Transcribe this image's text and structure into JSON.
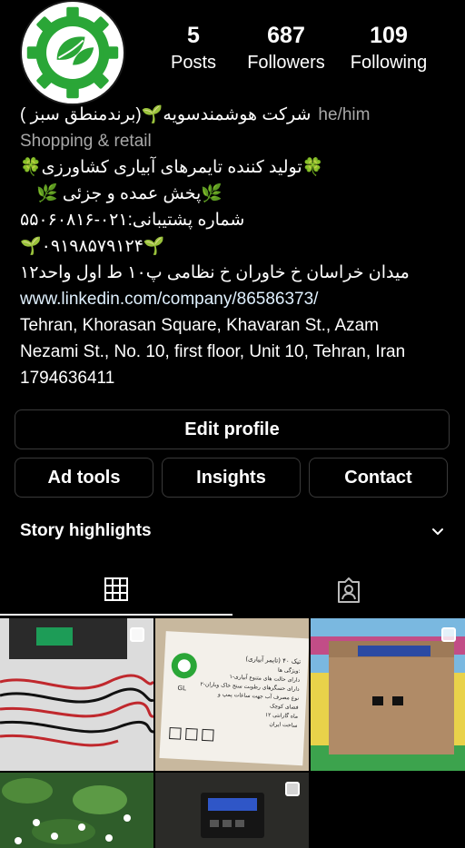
{
  "profile": {
    "stats": [
      {
        "value": "5",
        "label": "Posts"
      },
      {
        "value": "687",
        "label": "Followers"
      },
      {
        "value": "109",
        "label": "Following"
      }
    ],
    "pronouns": "he/him",
    "name_line": "شرکت هوشمندسویه🌱(برندمنطق سبز )",
    "category": "Shopping & retail",
    "bio_lines": [
      "🍀تولید کننده تایمرهای آبیاری کشاورزی🍀",
      "🌿پخش عمده و جزئی 🌿",
      "شماره پشتیبانی:۰۲۱-۵۵۰۶۰۸۱۶",
      "🌱۰۹۱۹۸۵۷۹۱۲۴🌱",
      "میدان خراسان خ خاوران خ نظامی پ۱۰ ط اول واحد۱۲"
    ],
    "website": "www.linkedin.com/company/86586373/",
    "address_lines": [
      "Tehran, Khorasan Square, Khavaran St., Azam",
      "Nezami St., No. 10, first floor, Unit 10, Tehran, Iran",
      "1794636411"
    ]
  },
  "buttons": {
    "edit_profile": "Edit profile",
    "ad_tools": "Ad tools",
    "insights": "Insights",
    "contact": "Contact"
  },
  "highlights": {
    "title": "Story highlights"
  },
  "tabs": {
    "grid_icon": "grid-icon",
    "tagged_icon": "tagged-person-icon"
  },
  "colors": {
    "brand_green": "#2aa637",
    "background": "#000000",
    "border": "#3a3a3a"
  },
  "post_card": {
    "heading": "تیک ۴۰ (تایمر آبیاری)",
    "subheading": "ویژگی ها:",
    "brand": "GL",
    "lines": [
      "۱-دارای حالت های متنوع آبیاری",
      "۲-دارای حسگرهای رطوبت سنج خاک وباران",
      "نوع مصرف آب جهت ساعات پمپ و",
      "فضای کوچک",
      "۱۲ ماه گارانتی",
      "ساخت ایران"
    ]
  }
}
